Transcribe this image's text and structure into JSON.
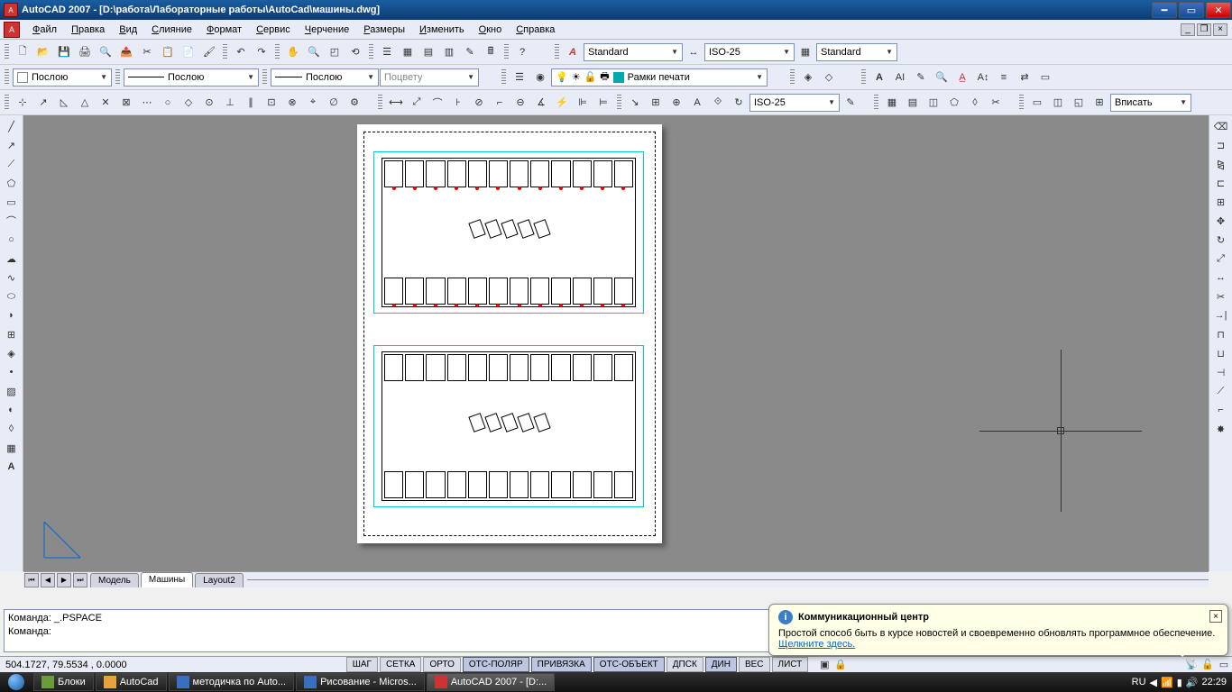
{
  "title": "AutoCAD 2007 - [D:\\работа\\Лабораторные работы\\AutoCad\\машины.dwg]",
  "menu": [
    "Файл",
    "Правка",
    "Вид",
    "Слияние",
    "Формат",
    "Сервис",
    "Черчение",
    "Размеры",
    "Изменить",
    "Окно",
    "Справка"
  ],
  "styles": {
    "textStyle": "Standard",
    "dimStyle": "ISO-25",
    "tableStyle": "Standard",
    "dimStyle2": "ISO-25",
    "fit": "Вписать"
  },
  "layer": {
    "combo1": "Послою",
    "combo2": "Послою",
    "combo3": "Послою",
    "combo4": "Поцвету"
  },
  "layer_toolbar_label": "Рамки печати",
  "tabs": {
    "model": "Модель",
    "layout1": "Машины",
    "layout2": "Layout2"
  },
  "command": {
    "prev": "Команда: _.PSPACE",
    "prompt": "Команда:"
  },
  "status": {
    "coords": "504.1727,  79.5534 , 0.0000",
    "toggles": [
      "ШАГ",
      "СЕТКА",
      "ОРТО",
      "ОТС-ПОЛЯР",
      "ПРИВЯЗКА",
      "ОТС-ОБЪЕКТ",
      "ДПСК",
      "ДИН",
      "ВЕС",
      "ЛИСТ"
    ],
    "toggles_on": [
      3,
      4,
      5,
      7
    ]
  },
  "balloon": {
    "title": "Коммуникационный центр",
    "body": "Простой способ быть в курсе новостей и своевременно обновлять программное обеспечение.",
    "link": "Щелкните здесь."
  },
  "taskbar": {
    "items": [
      "Блоки",
      "AutoCad",
      "методичка по Auto...",
      "Рисование - Micros...",
      "AutoCAD 2007 - [D:..."
    ],
    "lang": "RU",
    "time": "22:29"
  }
}
